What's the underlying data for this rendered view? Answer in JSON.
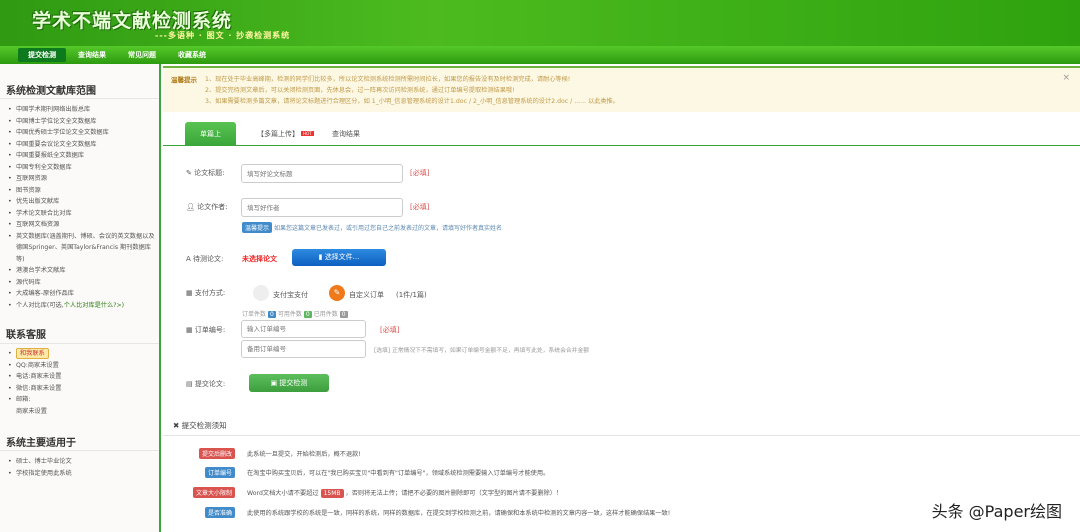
{
  "header": {
    "title": "学术不端文献检测系统",
    "slogan": "---多语种 · 图文 · 抄袭检测系统"
  },
  "nav": [
    "提交检测",
    "查询结果",
    "常见问题",
    "收藏系统"
  ],
  "sidebar": {
    "scope_title": "系统检测文献库范围",
    "scope_items": [
      "中国学术期刊网络出版总库",
      "中国博士学位论文全文数据库",
      "中国优秀硕士学位论文全文数据库",
      "中国重要会议论文全文数据库",
      "中国重要报纸全文数据库",
      "中国专利全文数据库",
      "互联网资源",
      "图书资源",
      "优先出版文献库",
      "学术论文联合比对库",
      "互联网文档资源",
      "英文数据库(涵盖期刊、博硕、会议的英文数据以及德国Springer、英国Taylor&Francis 期刊数据库等)",
      "港澳台学术文献库",
      "源代码库",
      "大成编客-原创作品库"
    ],
    "personal_item": "个人对比库(可选,",
    "personal_link": "个人比对库是什么?>)",
    "contact_title": "联系客服",
    "contact_qq_badge": "和我联系",
    "contact_items": [
      "QQ:商家未设置",
      "电话:商家未设置",
      "微信:商家未设置",
      "邮箱:"
    ],
    "email_value": "商家未设置",
    "usage_title": "系统主要适用于",
    "usage_items": [
      "硕士、博士毕业论文",
      "学校指定使用此系统"
    ]
  },
  "alert": {
    "title": "温馨提示",
    "lines": [
      "1、现在处于毕业高峰期，检测的同学们比较多，所以论文检测系统检测所需时间拉长，如果您的报告没有及时检测完成，请耐心等候!",
      "2、提交完待测文章后，可以关闭检测页面，先休息会，过一阵再次访问检测系统，通过订单编号提取检测结果哦!",
      "3、如果需要检测多篇文章，请将论文标题进行合理区分，如 1_小明_信息管理系统的设计1.doc / 2_小明_信息管理系统的设计2.doc / ...... 以此类推。"
    ],
    "close": "×"
  },
  "tabs": {
    "single": "单篇上传",
    "multi": "【多篇上传】",
    "hot": "HOT",
    "query": "查询结果"
  },
  "form": {
    "title_label": "论文标题:",
    "title_placeholder": "填写好论文标题",
    "required": "[必填]",
    "author_label": "论文作者:",
    "author_placeholder": "填写好作者",
    "hint_badge": "温馨提示",
    "hint_text": "如果您这篇文章已发表过，或引用过您自己之前发表过的文章，请填写好作者真实姓名",
    "file_label": "待测论文:",
    "file_status": "未选择论文",
    "file_button": "选择文件...",
    "pay_label": "支付方式:",
    "pay_alipay": "支付宝支付",
    "pay_custom": "自定义订单",
    "pay_custom_note": "(1件/1篇)",
    "count_order": "订单件数",
    "count_order_val": "0",
    "count_avail": "可用件数",
    "count_avail_val": "0",
    "count_used": "已用件数",
    "count_used_val": "0",
    "order_label": "订单编号:",
    "order_placeholder": "输入订单编号",
    "backup_placeholder": "备用订单编号",
    "backup_note": "[选填] 正常情况下不需填写，如果订单编号金额不足，再填写此处，系统会合并金额",
    "submit_label": "提交论文:",
    "submit_button": "提交检测"
  },
  "notice": {
    "title": "提交检测须知",
    "rows": [
      {
        "badge": "提交后删改",
        "color": "#d9534f",
        "text": "此系统一旦提交，开始检测后，概不退款!"
      },
      {
        "badge": "订单编号",
        "color": "#428bca",
        "text": "在淘宝中购买宝贝后，可以在\"我已购买宝贝\"中看到有\"订单编号\"，领域系统检测需要输入订单编号才能使用。"
      },
      {
        "badge": "文章大小限制",
        "color": "#d9534f",
        "text": "Word文档大小请不要超过",
        "size": "15MB",
        "text2": "，否则将无法上传；请把不必要的图片删除即可（文字型的图片请不要删除）！"
      },
      {
        "badge": "是否准确",
        "color": "#428bca",
        "text": "此使用的系统跟学校的系统是一致，同样的系统，同样的数据库，在提交到学校检测之前，请确保和本系统中检测的文章内容一致，这样才能确保结果一致!"
      }
    ]
  },
  "watermark": "头条 @Paper绘图",
  "colors": {
    "brand": "#3aa63a",
    "danger": "#d9534f",
    "info": "#428bca"
  }
}
